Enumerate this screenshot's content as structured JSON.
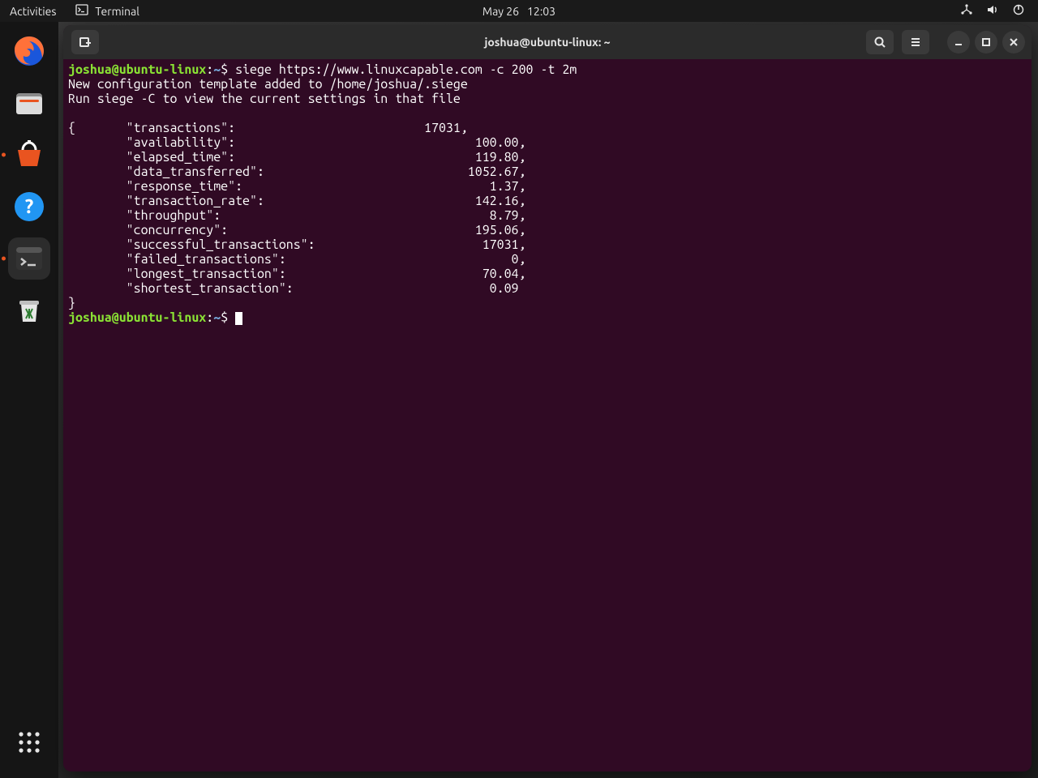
{
  "topbar": {
    "activities": "Activities",
    "app_label": "Terminal",
    "date": "May 26",
    "time": "12:03"
  },
  "dock": {
    "items": [
      {
        "name": "firefox"
      },
      {
        "name": "files"
      },
      {
        "name": "software"
      },
      {
        "name": "help"
      },
      {
        "name": "terminal"
      },
      {
        "name": "trash"
      }
    ]
  },
  "window": {
    "title": "joshua@ubuntu-linux: ~"
  },
  "terminal": {
    "prompt": {
      "user": "joshua",
      "host": "ubuntu-linux",
      "path": "~",
      "symbol": "$"
    },
    "command": "siege https://www.linuxcapable.com -c 200 -t 2m",
    "output_lines": [
      "New configuration template added to /home/joshua/.siege",
      "Run siege -C to view the current settings in that file",
      ""
    ],
    "result_open": "{",
    "result_close": "}",
    "results": [
      {
        "key": "transactions",
        "value": "17031",
        "comma": ","
      },
      {
        "key": "availability",
        "value": "100.00",
        "comma": ","
      },
      {
        "key": "elapsed_time",
        "value": "119.80",
        "comma": ","
      },
      {
        "key": "data_transferred",
        "value": "1052.67",
        "comma": ","
      },
      {
        "key": "response_time",
        "value": "1.37",
        "comma": ","
      },
      {
        "key": "transaction_rate",
        "value": "142.16",
        "comma": ","
      },
      {
        "key": "throughput",
        "value": "8.79",
        "comma": ","
      },
      {
        "key": "concurrency",
        "value": "195.06",
        "comma": ","
      },
      {
        "key": "successful_transactions",
        "value": "17031",
        "comma": ","
      },
      {
        "key": "failed_transactions",
        "value": "0",
        "comma": ","
      },
      {
        "key": "longest_transaction",
        "value": "70.04",
        "comma": ","
      },
      {
        "key": "shortest_transaction",
        "value": "0.09",
        "comma": ""
      }
    ]
  }
}
